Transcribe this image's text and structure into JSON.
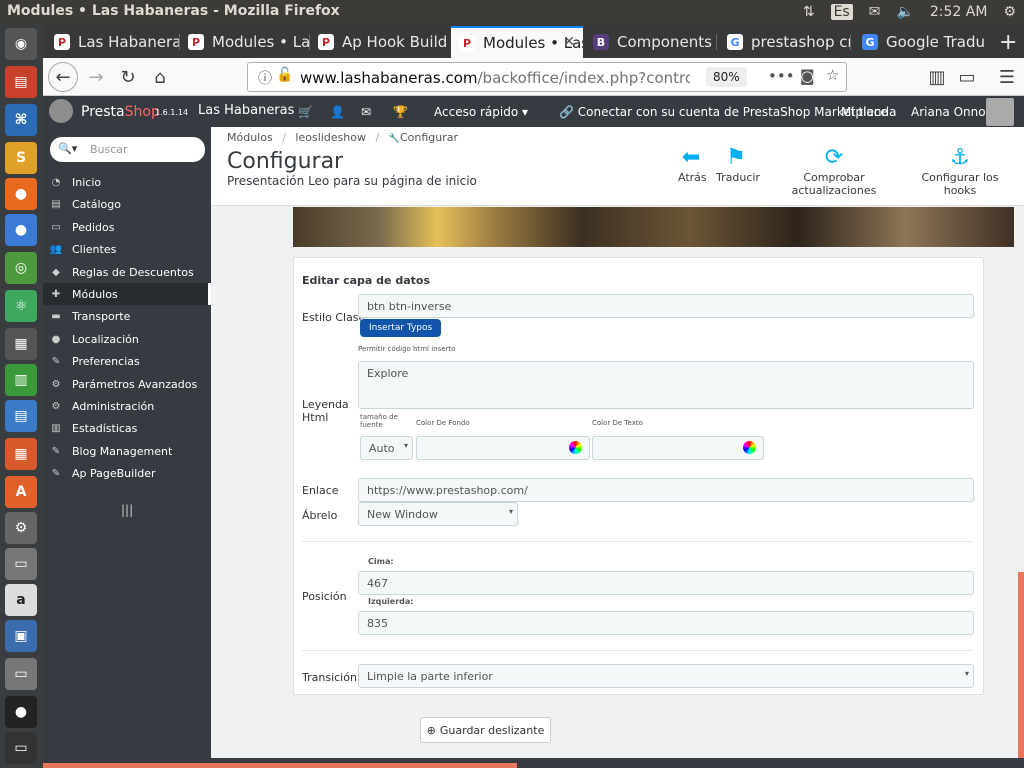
{
  "system": {
    "window_title": "Modules • Las Habaneras - Mozilla Firefox",
    "keyboard_lang": "Es",
    "clock": "2:52 AM"
  },
  "browser": {
    "tabs": [
      {
        "label": "Las Habanera",
        "icon": "prestashop-favicon",
        "active": false
      },
      {
        "label": "Modules • Las",
        "icon": "prestashop-favicon",
        "active": false
      },
      {
        "label": "Ap Hook Build",
        "icon": "prestashop-favicon",
        "active": false
      },
      {
        "label": "Modules • Las",
        "icon": "prestashop-favicon",
        "active": true
      },
      {
        "label": "Components",
        "icon": "bootstrap-favicon",
        "active": false
      },
      {
        "label": "prestashop cr",
        "icon": "google-favicon",
        "active": false
      },
      {
        "label": "Google Tradu",
        "icon": "google-translate-favicon",
        "active": false
      }
    ],
    "url_domain": "www.lashabaneras.com",
    "url_path": "/backoffice/index.php?contro",
    "zoom": "80%"
  },
  "header": {
    "brand": "PrestaShop",
    "brand_prefix": "Presta",
    "brand_suffix": "Shop",
    "version": "1.6.1.14",
    "shop_name": "Las Habaneras",
    "quick_access": "Acceso rápido",
    "marketplace": "Conectar con su cuenta de PrestaShop Marketplace",
    "my_shop": "Mi tienda",
    "user": "Ariana Onno"
  },
  "sidebar": {
    "search_placeholder": "Buscar",
    "items": [
      {
        "label": "Inicio",
        "icon": "dashboard-icon"
      },
      {
        "label": "Catálogo",
        "icon": "book-icon"
      },
      {
        "label": "Pedidos",
        "icon": "credit-card-icon"
      },
      {
        "label": "Clientes",
        "icon": "users-icon"
      },
      {
        "label": "Reglas de Descuentos",
        "icon": "tag-icon"
      },
      {
        "label": "Módulos",
        "icon": "puzzle-icon"
      },
      {
        "label": "Transporte",
        "icon": "truck-icon"
      },
      {
        "label": "Localización",
        "icon": "globe-icon"
      },
      {
        "label": "Preferencias",
        "icon": "wrench-icon"
      },
      {
        "label": "Parámetros Avanzados",
        "icon": "cogs-icon"
      },
      {
        "label": "Administración",
        "icon": "cog-icon"
      },
      {
        "label": "Estadísticas",
        "icon": "bar-chart-icon"
      },
      {
        "label": "Blog Management",
        "icon": "pencil-icon"
      },
      {
        "label": "Ap PageBuilder",
        "icon": "pencil-icon"
      }
    ]
  },
  "page": {
    "breadcrumb": [
      "Módulos",
      "leoslideshow",
      "Configurar"
    ],
    "title": "Configurar",
    "subtitle": "Presentación Leo para su página de inicio",
    "toolbar": [
      {
        "label": "Atrás",
        "icon": "arrow-left-circle-icon"
      },
      {
        "label": "Traducir",
        "icon": "flag-icon"
      },
      {
        "label": "Comprobar actualizaciones",
        "icon": "refresh-icon"
      },
      {
        "label": "Configurar los hooks",
        "icon": "anchor-icon"
      }
    ]
  },
  "form": {
    "panel_title": "Editar capa de datos",
    "estilo_label": "Estilo Clase",
    "estilo_value": "btn btn-inverse",
    "insert_typos": "Insertar Typos",
    "allow_html": "Permitir código html inserto",
    "leyenda_label": "Leyenda Html",
    "leyenda_value": "Explore",
    "font_size_label": "tamaño de fuente",
    "font_size_value": "Auto",
    "bg_color_label": "Color De Fondo",
    "text_color_label": "Color De Texto",
    "link_label": "Enlace",
    "link_value": "https://www.prestashop.com/",
    "open_label": "Ábrelo",
    "open_value": "New Window",
    "position_label": "Posición",
    "top_label": "Cima:",
    "top_value": "467",
    "left_label": "Izquierda:",
    "left_value": "835",
    "transition_label": "Transición",
    "transition_value": "Limpie la parte inferior",
    "save_label": "Guardar deslizante"
  },
  "colors": {
    "header_bg": "#363a41",
    "accent": "#00aff0",
    "brand_red": "#fb6564",
    "button_blue": "#1155aa"
  }
}
